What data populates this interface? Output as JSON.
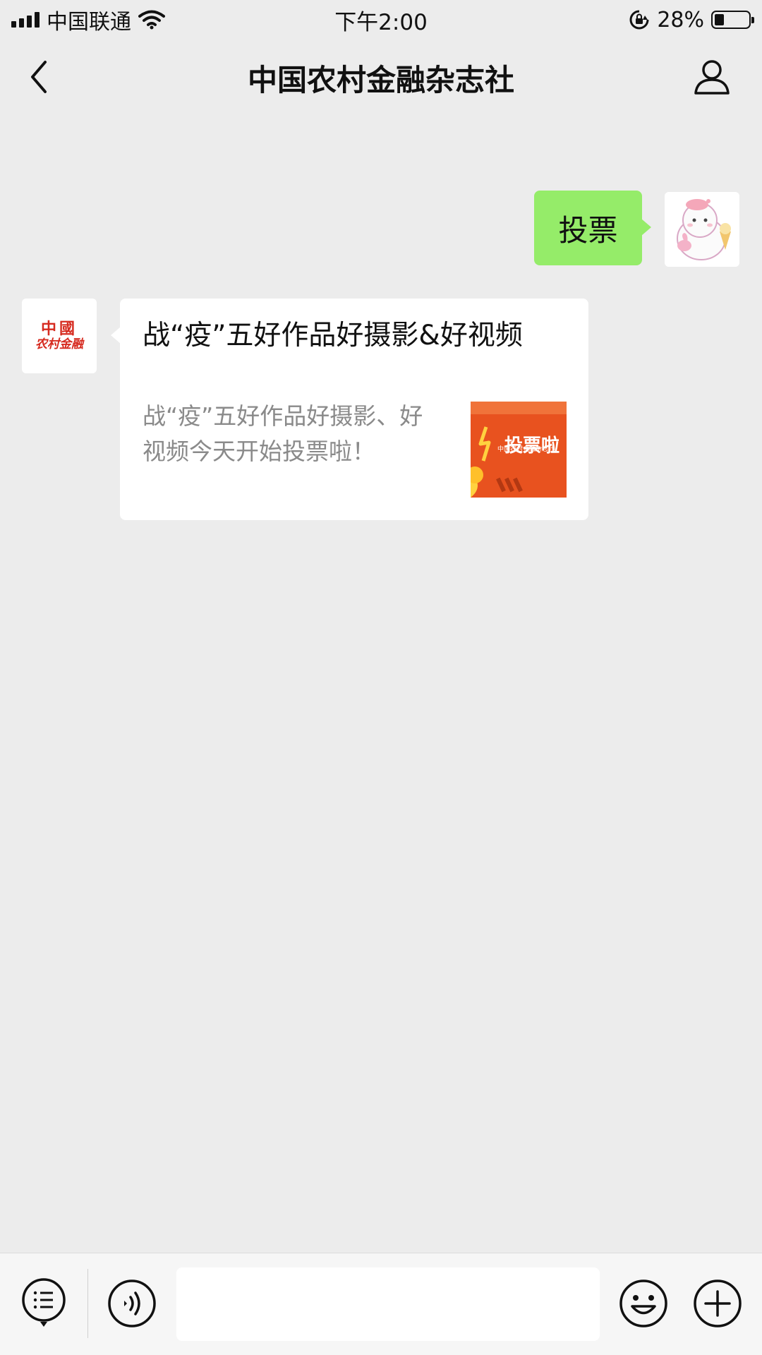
{
  "status_bar": {
    "carrier": "中国联通",
    "time": "下午2:00",
    "battery_percent": "28%",
    "battery_level": 0.28,
    "icons": [
      "signal-icon",
      "wifi-icon",
      "rotation-lock-icon",
      "battery-icon"
    ]
  },
  "nav": {
    "title": "中国农村金融杂志社",
    "back_icon": "chevron-left-icon",
    "profile_icon": "person-icon"
  },
  "messages": {
    "outgoing": {
      "text": "投票"
    },
    "incoming": {
      "avatar_text_line1": "中國",
      "avatar_text_line2": "农村金融",
      "card_title": "战“疫”五好作品好摄影&好视频",
      "card_desc": "战“疫”五好作品好摄影、好视频今天开始投票啦！",
      "thumbnail_text": "投票啦",
      "thumbnail_small_text": "中国农村金融杂志社"
    }
  },
  "input_bar": {
    "menu_icon": "list-menu-icon",
    "voice_icon": "voice-icon",
    "input_value": "",
    "emoji_icon": "emoji-icon",
    "plus_icon": "plus-icon"
  },
  "colors": {
    "background": "#ececec",
    "outgoing_bubble": "#95ec69",
    "thumb_orange": "#e8521f",
    "org_red": "#d62a1f"
  }
}
